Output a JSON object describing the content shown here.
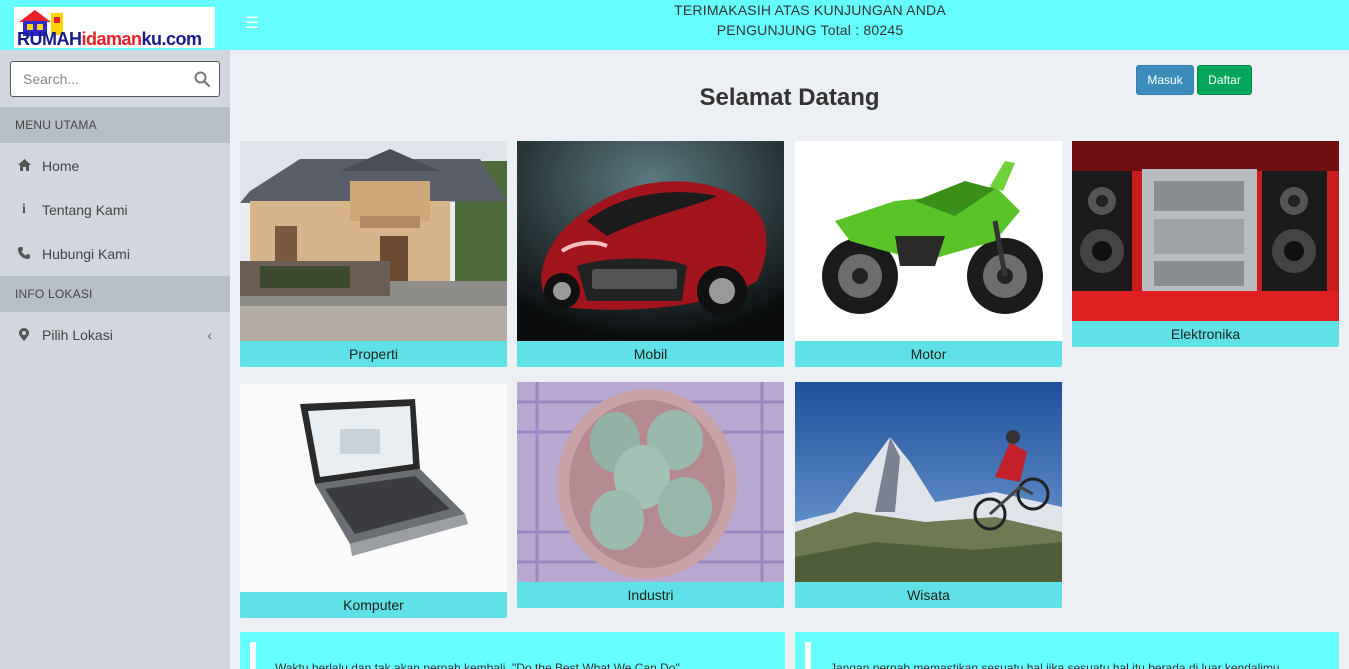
{
  "header": {
    "logo_text_1": "RUMAH",
    "logo_text_2": "idaman",
    "logo_text_3": "ku.com",
    "line1": "TERIMAKASIH ATAS KUNJUNGAN ANDA",
    "line2": "PENGUNJUNG Total : 80245"
  },
  "sidebar": {
    "search_placeholder": "Search...",
    "sections": [
      {
        "title": "MENU UTAMA",
        "items": [
          {
            "label": "Home",
            "icon": "home-icon"
          },
          {
            "label": "Tentang Kami",
            "icon": "info-icon"
          },
          {
            "label": "Hubungi Kami",
            "icon": "phone-icon"
          }
        ]
      },
      {
        "title": "INFO LOKASI",
        "items": [
          {
            "label": "Pilih Lokasi",
            "icon": "map-marker-icon"
          }
        ]
      }
    ]
  },
  "main": {
    "title": "Selamat Datang",
    "login_label": "Masuk",
    "register_label": "Daftar",
    "categories": [
      {
        "label": "Properti"
      },
      {
        "label": "Mobil"
      },
      {
        "label": "Motor"
      },
      {
        "label": "Elektronika"
      },
      {
        "label": "Komputer"
      },
      {
        "label": "Industri"
      },
      {
        "label": "Wisata"
      }
    ],
    "quotes": [
      "Waktu berlalu dan tak akan pernah kembali. \"Do the Best What We Can Do\"",
      "Jangan pernah memastikan sesuatu hal jika sesuatu hal itu berada di luar kendalimu"
    ]
  },
  "colors": {
    "header_bg": "#66ffff",
    "sidebar_bg": "#d2d6de",
    "caption_bg": "#5ee2e8",
    "masuk_btn": "#3c8dbc",
    "daftar_btn": "#00a65a"
  }
}
